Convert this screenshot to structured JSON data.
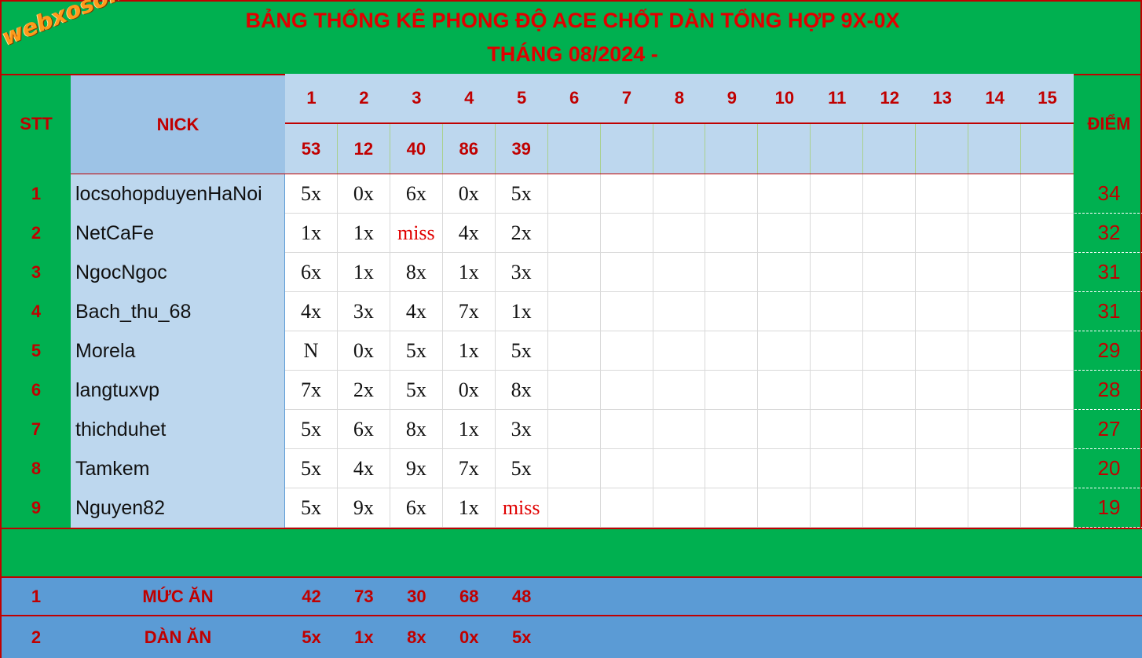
{
  "title": {
    "line1": "BẢNG THỐNG KÊ PHONG ĐỘ ACE CHỐT DÀN TỔNG HỢP 9X-0X",
    "line2": "THÁNG 08/2024 -"
  },
  "logo_text": "webxoso.net",
  "header": {
    "stt": "STT",
    "nick": "NICK",
    "diem": "ĐIỂM",
    "day_numbers": [
      "1",
      "2",
      "3",
      "4",
      "5",
      "6",
      "7",
      "8",
      "9",
      "10",
      "11",
      "12",
      "13",
      "14",
      "15"
    ],
    "day_results": [
      "53",
      "12",
      "40",
      "86",
      "39",
      "",
      "",
      "",
      "",
      "",
      "",
      "",
      "",
      "",
      ""
    ]
  },
  "rows": [
    {
      "stt": "1",
      "nick": "locsohopduyenHaNoi",
      "scores": [
        "5x",
        "0x",
        "6x",
        "0x",
        "5x"
      ],
      "diem": "34"
    },
    {
      "stt": "2",
      "nick": "NetCaFe",
      "scores": [
        "1x",
        "1x",
        "miss",
        "4x",
        "2x"
      ],
      "diem": "32"
    },
    {
      "stt": "3",
      "nick": "NgocNgoc",
      "scores": [
        "6x",
        "1x",
        "8x",
        "1x",
        "3x"
      ],
      "diem": "31"
    },
    {
      "stt": "4",
      "nick": "Bach_thu_68",
      "scores": [
        "4x",
        "3x",
        "4x",
        "7x",
        "1x"
      ],
      "diem": "31"
    },
    {
      "stt": "5",
      "nick": "Morela",
      "scores": [
        "N",
        "0x",
        "5x",
        "1x",
        "5x"
      ],
      "diem": "29"
    },
    {
      "stt": "6",
      "nick": "langtuxvp",
      "scores": [
        "7x",
        "2x",
        "5x",
        "0x",
        "8x"
      ],
      "diem": "28"
    },
    {
      "stt": "7",
      "nick": "thichduhet",
      "scores": [
        "5x",
        "6x",
        "8x",
        "1x",
        "3x"
      ],
      "diem": "27"
    },
    {
      "stt": "8",
      "nick": "Tamkem",
      "scores": [
        "5x",
        "4x",
        "9x",
        "7x",
        "5x"
      ],
      "diem": "20"
    },
    {
      "stt": "9",
      "nick": "Nguyen82",
      "scores": [
        "5x",
        "9x",
        "6x",
        "1x",
        "miss"
      ],
      "diem": "19"
    }
  ],
  "footer": {
    "muc_an": {
      "stt": "1",
      "label": "MỨC ĂN",
      "values": [
        "42",
        "73",
        "30",
        "68",
        "48"
      ]
    },
    "dan_an": {
      "stt": "2",
      "label": "DÀN ĂN",
      "values": [
        "5x",
        "1x",
        "8x",
        "0x",
        "5x"
      ]
    }
  },
  "colors": {
    "green_bg": "#00b050",
    "header_blue": "#bdd7ee",
    "nick_header_blue": "#9dc3e6",
    "footer_blue": "#5b9bd5",
    "accent_red": "#c00000",
    "logo_orange": "#ff9a1a"
  }
}
